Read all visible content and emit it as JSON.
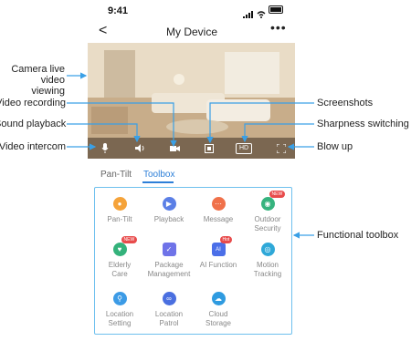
{
  "status": {
    "time": "9:41"
  },
  "header": {
    "title": "My Device",
    "back_icon": "chevron-left-icon",
    "more_icon": "more-icon",
    "more_glyph": "•••",
    "back_glyph": "<"
  },
  "camera": {
    "controls": [
      {
        "name": "intercom",
        "icon": "microphone-icon"
      },
      {
        "name": "sound",
        "icon": "speaker-icon"
      },
      {
        "name": "record",
        "icon": "video-camera-icon"
      },
      {
        "name": "screenshot",
        "icon": "screenshot-icon"
      },
      {
        "name": "sharpness",
        "label": "HD"
      },
      {
        "name": "blowup",
        "icon": "fullscreen-icon"
      }
    ]
  },
  "callouts": {
    "live": "Camera live\nvideo viewing",
    "recording": "Video recording",
    "sound": "Sound playback",
    "intercom": "Video intercom",
    "screenshots": "Screenshots",
    "sharpness": "Sharpness switching",
    "blowup": "Blow up",
    "toolbox": "Functional toolbox"
  },
  "tabs": [
    {
      "label": "Pan-Tilt",
      "active": false
    },
    {
      "label": "Toolbox",
      "active": true
    }
  ],
  "toolbox": [
    {
      "label": "Pan-Tilt",
      "icon": "pan-tilt-icon",
      "color": "#f5a33a"
    },
    {
      "label": "Playback",
      "icon": "playback-icon",
      "color": "#5b7fe6"
    },
    {
      "label": "Message",
      "icon": "message-icon",
      "color": "#f0714a"
    },
    {
      "label": "Outdoor\nSecurity",
      "icon": "outdoor-security-icon",
      "color": "#36b37e",
      "badge": "NEW"
    },
    {
      "label": "Elderly\nCare",
      "icon": "elderly-care-icon",
      "color": "#34b27b",
      "badge": "NEW"
    },
    {
      "label": "Package\nManagement",
      "icon": "package-icon",
      "color": "#6f73e8"
    },
    {
      "label": "AI Function",
      "icon": "ai-icon",
      "color": "#4b6fe8",
      "badge": "Hot"
    },
    {
      "label": "Motion\nTracking",
      "icon": "motion-tracking-icon",
      "color": "#2fa8d8"
    },
    {
      "label": "Location\nSetting",
      "icon": "location-setting-icon",
      "color": "#3c9be6"
    },
    {
      "label": "Location\nPatrol",
      "icon": "location-patrol-icon",
      "color": "#4a6fe0"
    },
    {
      "label": "Cloud\nStorage",
      "icon": "cloud-storage-icon",
      "color": "#2f9be0"
    }
  ],
  "colors": {
    "accent": "#2d7fd8",
    "arrow": "#3aa0e6",
    "toolbox_border": "#6ec0ee"
  }
}
